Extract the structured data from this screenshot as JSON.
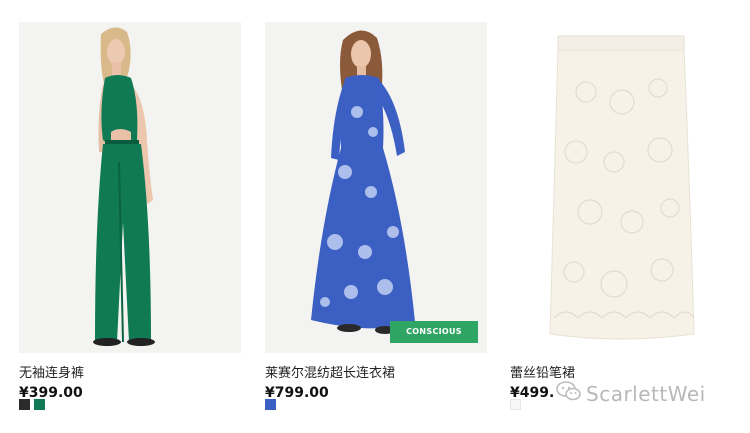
{
  "products": [
    {
      "name": "无袖连身裤",
      "price": "¥399.00",
      "swatches": [
        "#2b2b2b",
        "#0f7a54"
      ],
      "image": "green-jumpsuit-model"
    },
    {
      "name": "莱赛尔混纺超长连衣裙",
      "price": "¥799.00",
      "swatches": [
        "#3c5fc4"
      ],
      "badge": "CONSCIOUS",
      "image": "blue-print-maxi-dress-model"
    },
    {
      "name": "蕾丝铅笔裙",
      "price": "¥499.",
      "swatches": [
        "#f6f6f6"
      ],
      "image": "white-lace-pencil-skirt"
    }
  ],
  "watermark": {
    "text": "ScarlettWei",
    "icon": "wechat-icon"
  }
}
